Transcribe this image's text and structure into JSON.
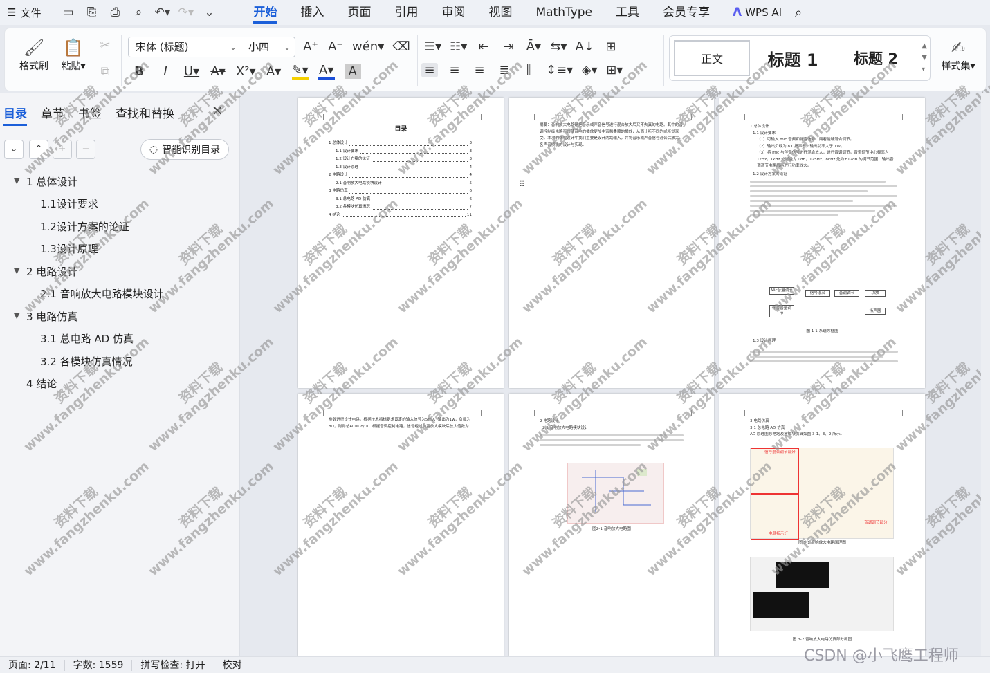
{
  "menubar": {
    "file_label": "文件",
    "tabs": [
      "开始",
      "插入",
      "页面",
      "引用",
      "审阅",
      "视图",
      "MathType",
      "工具",
      "会员专享"
    ],
    "active_tab": "开始",
    "wps_ai": "WPS AI"
  },
  "ribbon": {
    "format_painter": "格式刷",
    "paste": "粘贴",
    "font_name": "宋体 (标题)",
    "font_size": "小四",
    "styles": {
      "normal": "正文",
      "heading1": "标题 1",
      "heading2": "标题 2"
    },
    "styles_button": "样式集"
  },
  "nav": {
    "tabs": [
      "目录",
      "章节",
      "书签",
      "查找和替换"
    ],
    "active_tab": "目录",
    "smart_button": "智能识别目录",
    "toc": [
      {
        "label": "1 总体设计",
        "level": 1,
        "expanded": true
      },
      {
        "label": "1.1设计要求",
        "level": 2
      },
      {
        "label": "1.2设计方案的论证",
        "level": 2
      },
      {
        "label": "1.3设计原理",
        "level": 2
      },
      {
        "label": "2 电路设计",
        "level": 1,
        "expanded": true
      },
      {
        "label": "2.1 音响放大电路模块设计",
        "level": 2
      },
      {
        "label": "3 电路仿真",
        "level": 1,
        "expanded": true
      },
      {
        "label": "3.1 总电路 AD 仿真",
        "level": 2
      },
      {
        "label": "3.2 各模块仿真情况",
        "level": 2
      },
      {
        "label": "4 结论",
        "level": 1
      }
    ]
  },
  "pages": {
    "p1": {
      "title": "目录",
      "toc": [
        {
          "label": "1 总体设计",
          "page": "3"
        },
        {
          "label": "1.1 设计要求",
          "page": "3"
        },
        {
          "label": "1.2 设计方案的论证",
          "page": "3"
        },
        {
          "label": "1.3 设计原理",
          "page": "4"
        },
        {
          "label": "2 电路设计",
          "page": "4"
        },
        {
          "label": "2.1 音响放大电路模块设计",
          "page": "5"
        },
        {
          "label": "3 电路仿真",
          "page": "6"
        },
        {
          "label": "3.1 总电路 AD 仿真",
          "page": "6"
        },
        {
          "label": "3.2 各模块仿真情况",
          "page": "7"
        },
        {
          "label": "4 结论",
          "page": "11"
        }
      ]
    },
    "p2": {
      "text": "摘要：音响放大电路是把音乐或声音信号进行混合放大后又不失真的电路。其中的音调控制级电路可以使音响的播放更加丰富和柔顺的播放，从而让听不同的或听觉享受。本次的课程设计中我们主要是设计两路输入，并将音乐或声音信号混合后放大，各声音模块的设计与实现。"
    },
    "p3": {
      "heading": "1 总体设计",
      "sub1": "1.1 设计要求",
      "req": [
        "（1）可输入 mic 音频和伴音信号，两者能够混合调节。",
        "（2）输出负载为 8 Ω扬声器，输出功率大于 1W。",
        "（3）将 mic 与伴音信号进行混合放大，进行音调调节。音调调节中心频率为 1kHz，1kHz 处增益为 0dB，125Hz、8kHz 处为±12dB 的调节范围，输出音调调节电路后再进行功率放大。"
      ],
      "sub2": "1.2 设计方案的论证",
      "blocks": [
        "Mic音量调节",
        "信号混合",
        "音调调节",
        "功放",
        "伴音音量调节",
        "扬声器"
      ],
      "fig": "图 1-1 系统方框图",
      "sub3": "1.3 设计原理"
    },
    "p4": {
      "text": "参数进行设计电路。根据技术指标要求设定的输入信号为5mv，输出为1w，负载为8Ω，则得总Au=Uo/Ui，根据音调控制电路，信号经过前置放大模块后放大倍数为..."
    },
    "p5": {
      "heading": "2 电路设计",
      "sub": "2.1 音响放大电路模块设计",
      "fig": "图2-1 音响放大电路图"
    },
    "p6": {
      "heading": "3 电路仿真",
      "sub": "3.1 总电路 AD 仿真",
      "intro": "AD 原理图总电路及各模块仿真如图 3-1、3、2 所示。",
      "label_mix": "信号混合调节部分",
      "label_tone": "音调调节部分",
      "label_power": "电源指示灯",
      "fig1": "图 3-1 音响放大电路原理图",
      "fig2": "图 3-2 音响放大电路仿真部分截图"
    }
  },
  "watermark": {
    "line1": "资料下载",
    "line2": "www.fangzhenku.com"
  },
  "status": {
    "page": "页面: 2/11",
    "words": "字数: 1559",
    "spell": "拼写检查: 打开",
    "proof": "校对"
  },
  "overlay": "CSDN @小飞鹰工程师"
}
